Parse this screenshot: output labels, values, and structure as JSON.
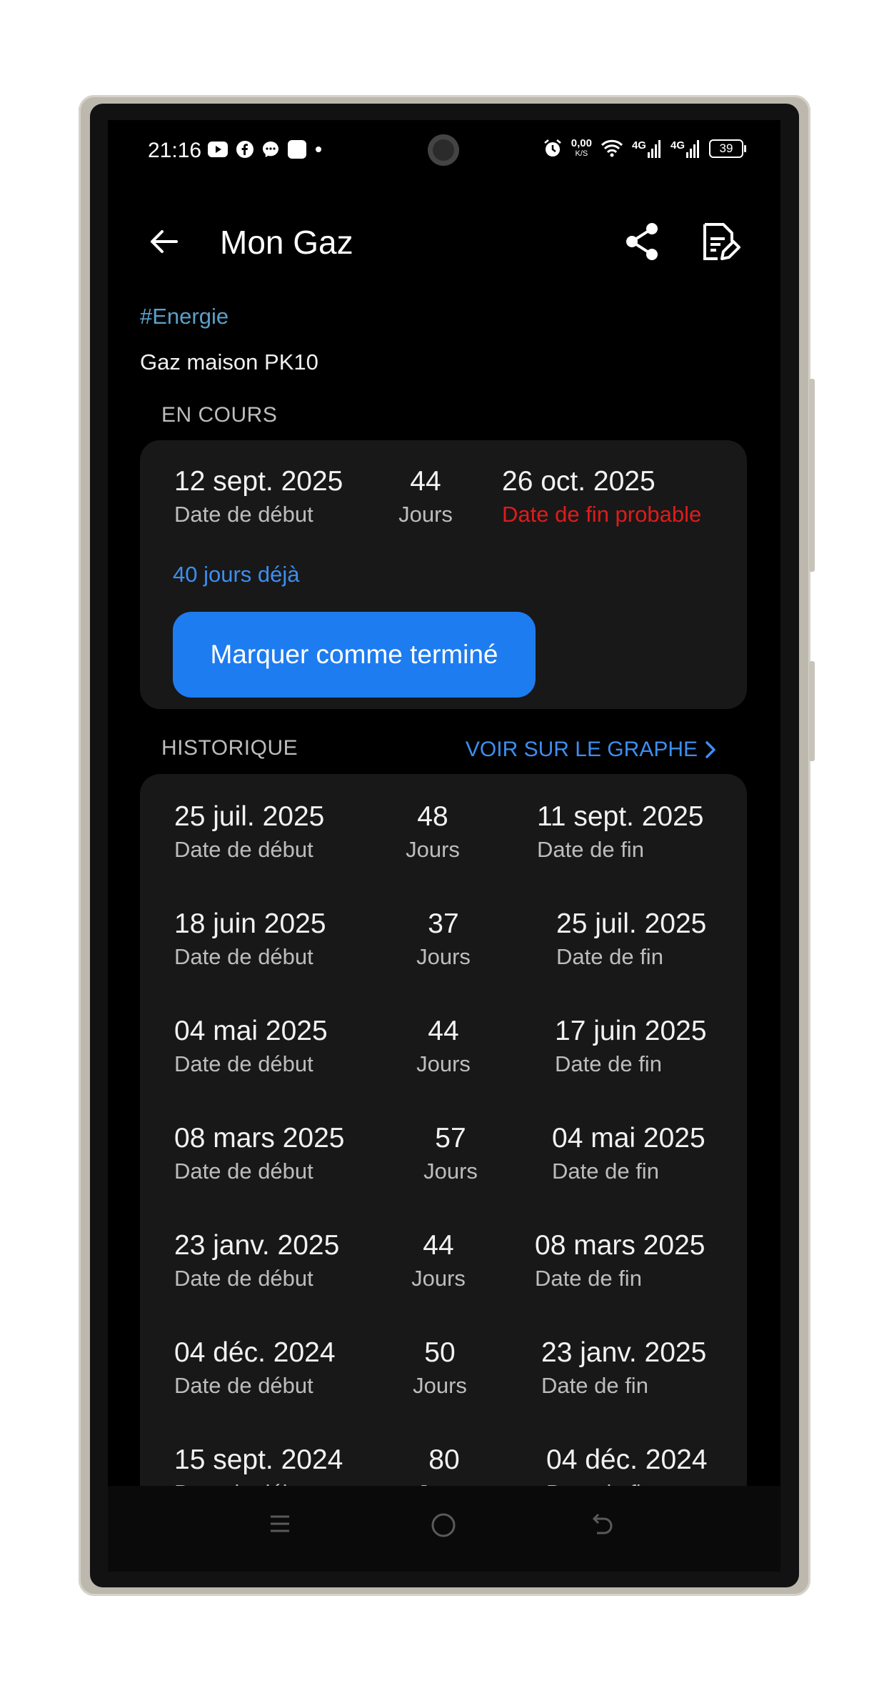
{
  "status_bar": {
    "time": "21:16",
    "net_speed_top": "0,00",
    "net_speed_unit": "K/S",
    "signal_1": "4G",
    "signal_2": "4G",
    "battery": "39"
  },
  "app_bar": {
    "title": "Mon Gaz"
  },
  "tag": "#Energie",
  "subtitle": "Gaz maison PK10",
  "current": {
    "section_label": "EN COURS",
    "start_date": "12 sept. 2025",
    "start_label": "Date de début",
    "days": "44",
    "days_label": "Jours",
    "end_date": "26 oct. 2025",
    "end_label": "Date de fin probable",
    "elapsed": "40 jours déjà",
    "finish_button": "Marquer comme terminé"
  },
  "history": {
    "section_label": "HISTORIQUE",
    "graph_link": "VOIR SUR LE GRAPHE",
    "rows": [
      {
        "start": "25 juil. 2025",
        "start_label": "Date de début",
        "days": "48",
        "days_label": "Jours",
        "end": "11 sept. 2025",
        "end_label": "Date de fin"
      },
      {
        "start": "18 juin 2025",
        "start_label": "Date de début",
        "days": "37",
        "days_label": "Jours",
        "end": "25 juil. 2025",
        "end_label": "Date de fin"
      },
      {
        "start": "04 mai 2025",
        "start_label": "Date de début",
        "days": "44",
        "days_label": "Jours",
        "end": "17 juin 2025",
        "end_label": "Date de fin"
      },
      {
        "start": "08 mars 2025",
        "start_label": "Date de début",
        "days": "57",
        "days_label": "Jours",
        "end": "04 mai 2025",
        "end_label": "Date de fin"
      },
      {
        "start": "23 janv. 2025",
        "start_label": "Date de début",
        "days": "44",
        "days_label": "Jours",
        "end": "08 mars 2025",
        "end_label": "Date de fin"
      },
      {
        "start": "04 déc. 2024",
        "start_label": "Date de début",
        "days": "50",
        "days_label": "Jours",
        "end": "23 janv. 2025",
        "end_label": "Date de fin"
      },
      {
        "start": "15 sept. 2024",
        "start_label": "Date de début",
        "days": "80",
        "days_label": "Jours",
        "end": "04 déc. 2024",
        "end_label": "Date de fin"
      }
    ]
  },
  "colors": {
    "accent": "#1d7cf0",
    "link": "#3d8ef0",
    "tag": "#5aa0c8",
    "warning": "#e01b1b",
    "card": "#181818"
  },
  "icons": [
    "back-arrow-icon",
    "share-icon",
    "edit-note-icon",
    "chevron-right-icon",
    "recents-icon",
    "home-icon",
    "back-icon"
  ]
}
